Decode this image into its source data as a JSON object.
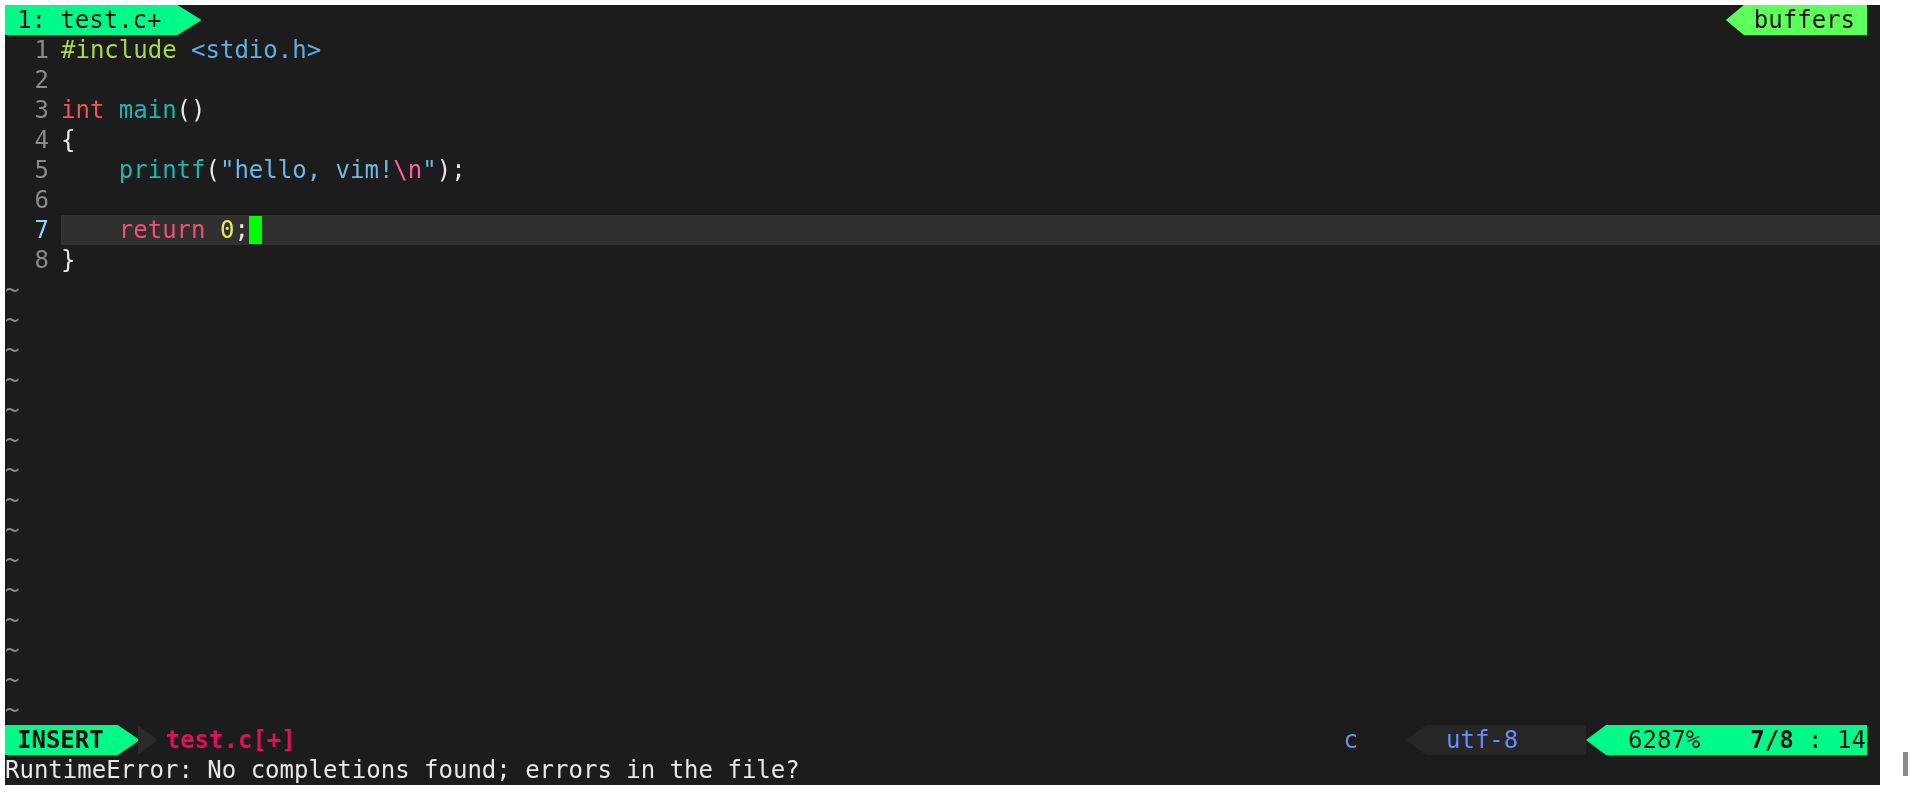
{
  "tabline": {
    "tabs": [
      {
        "label": "1: test.c+",
        "selected": true
      }
    ],
    "buffers_label": "buffers"
  },
  "lines": [
    {
      "number": "1",
      "current": false,
      "cursor": false,
      "tokens": [
        {
          "text": "#include",
          "kind": "preproc"
        },
        {
          "text": " <stdio.h>",
          "kind": "header"
        }
      ]
    },
    {
      "number": "2",
      "current": false,
      "cursor": false
    },
    {
      "number": "3",
      "current": false,
      "cursor": false,
      "tokens": [
        {
          "text": "int",
          "kind": "type"
        },
        {
          "text": " main",
          "kind": "function"
        },
        {
          "text": "()",
          "kind": "plain"
        }
      ]
    },
    {
      "number": "4",
      "current": false,
      "cursor": false,
      "tokens": [
        {
          "text": "{",
          "kind": "plain"
        }
      ]
    },
    {
      "number": "5",
      "current": false,
      "cursor": false,
      "tokens": [
        {
          "text": "    printf",
          "kind": "function"
        },
        {
          "text": "(",
          "kind": "plain"
        },
        {
          "text": "\"hello, vim!",
          "kind": "string"
        },
        {
          "text": "\\n",
          "kind": "escape"
        },
        {
          "text": "\"",
          "kind": "string"
        },
        {
          "text": ");",
          "kind": "plain"
        }
      ]
    },
    {
      "number": "6",
      "current": false,
      "cursor": false
    },
    {
      "number": "7",
      "current": true,
      "cursor": true,
      "tokens": [
        {
          "text": "    return",
          "kind": "keyword"
        },
        {
          "text": " 0",
          "kind": "number"
        },
        {
          "text": ";",
          "kind": "plain"
        }
      ]
    },
    {
      "number": "8",
      "current": false,
      "cursor": false,
      "tokens": [
        {
          "text": "}",
          "kind": "plain"
        }
      ]
    }
  ],
  "filler_lines": [
    "~",
    "~",
    "~",
    "~",
    "~",
    "~",
    "~",
    "~",
    "~",
    "~",
    "~",
    "~",
    "~",
    "~",
    "~"
  ],
  "status_line": {
    "mode": "INSERT",
    "file": "test.c[+]",
    "filetype": "c",
    "encoding": "utf-8",
    "percent": "6287%",
    "position": "**7/8** : 14"
  },
  "command_line": {
    "message": "RuntimeError: No completions found; errors in the file?"
  }
}
